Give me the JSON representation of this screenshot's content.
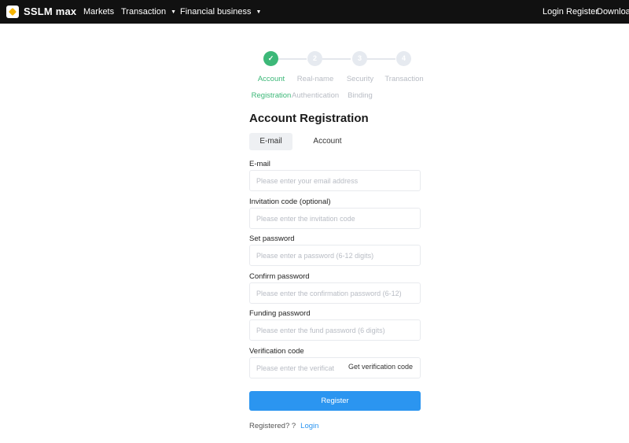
{
  "header": {
    "brand": "SSLM max",
    "nav": [
      {
        "label": "Markets"
      },
      {
        "label": "Transaction"
      },
      {
        "label": "Financial business"
      }
    ],
    "right": [
      {
        "label": "Login"
      },
      {
        "label": "Register"
      },
      {
        "label": "Download"
      }
    ]
  },
  "steps": [
    {
      "number": "✓",
      "line1": "Account",
      "line2": "Registration"
    },
    {
      "number": "2",
      "line1": "Real-name",
      "line2": "Authentication"
    },
    {
      "number": "3",
      "line1": "Security",
      "line2": "Binding"
    },
    {
      "number": "4",
      "line1": "Transaction",
      "line2": ""
    }
  ],
  "form": {
    "title": "Account Registration",
    "tabs": [
      {
        "label": "E-mail"
      },
      {
        "label": "Account"
      }
    ],
    "fields": [
      {
        "label": "E-mail",
        "placeholder": "Please enter your email address"
      },
      {
        "label": "Invitation code (optional)",
        "placeholder": "Please enter the invitation code"
      },
      {
        "label": "Set password",
        "placeholder": "Please enter a password (6-12 digits)"
      },
      {
        "label": "Confirm password",
        "placeholder": "Please enter the confirmation password (6-12)"
      },
      {
        "label": "Funding password",
        "placeholder": "Please enter the fund password (6 digits)"
      },
      {
        "label": "Verification code",
        "placeholder": "Please enter the verificat"
      }
    ],
    "get_code_label": "Get verification code",
    "register_label": "Register",
    "footer_text": "Registered? ?",
    "footer_link": "Login"
  },
  "colors": {
    "accent_blue": "#2b95f0",
    "step_active": "#3cb878",
    "topbar": "#111111"
  }
}
